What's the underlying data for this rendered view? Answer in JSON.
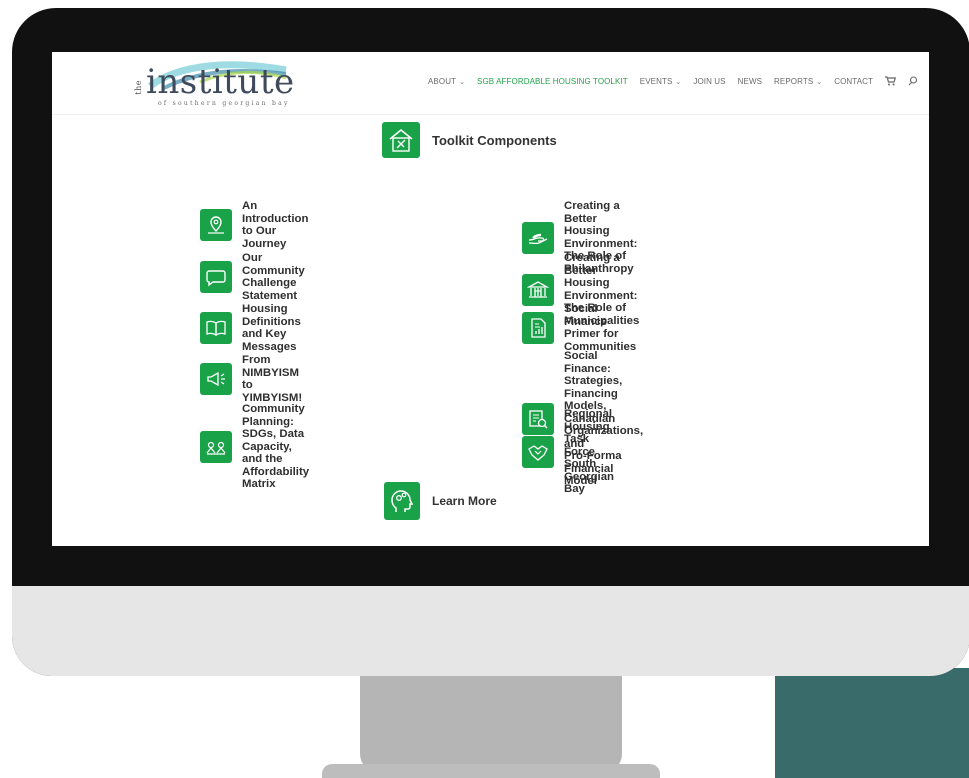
{
  "header": {
    "logo": {
      "prefix": "the",
      "main": "institute",
      "subtitle": "of southern georgian bay"
    },
    "nav": [
      {
        "label": "ABOUT",
        "dropdown": true,
        "active": false
      },
      {
        "label": "SGB AFFORDABLE HOUSING TOOLKIT",
        "dropdown": false,
        "active": true
      },
      {
        "label": "EVENTS",
        "dropdown": true,
        "active": false
      },
      {
        "label": "JOIN US",
        "dropdown": false,
        "active": false
      },
      {
        "label": "NEWS",
        "dropdown": false,
        "active": false
      },
      {
        "label": "REPORTS",
        "dropdown": true,
        "active": false
      },
      {
        "label": "CONTACT",
        "dropdown": false,
        "active": false
      }
    ],
    "nav_chevron": "⌄"
  },
  "main": {
    "title": "Toolkit Components",
    "items_left": [
      {
        "lines": [
          "An Introduction to Our Journey"
        ],
        "icon": "map-pin-icon"
      },
      {
        "lines": [
          "Our Community Challenge Statement"
        ],
        "icon": "speech-bubble-icon"
      },
      {
        "lines": [
          "Housing Definitions and Key Messages"
        ],
        "icon": "book-icon"
      },
      {
        "lines": [
          "From NIMBYISM to YIMBYISM!"
        ],
        "icon": "megaphone-icon"
      },
      {
        "lines": [
          "Community Planning: SDGs, Data",
          "Capacity, and the Affordability Matrix"
        ],
        "icon": "planning-icon"
      }
    ],
    "items_right": [
      {
        "lines": [
          "Creating a Better Housing Environment:",
          "The Role of Philanthropy"
        ],
        "icon": "hand-icon"
      },
      {
        "lines": [
          "Creating a Better Housing Environment:",
          "The Role of Municipalities"
        ],
        "icon": "municipal-building-icon"
      },
      {
        "lines": [
          "Social Finance Primer for Communities"
        ],
        "icon": "document-chart-icon"
      },
      {
        "lines": [
          "Social Finance: Strategies, Financing",
          "Models, Canadian Organizations, and",
          "Pro-Forma Financial Model"
        ],
        "icon": "financial-report-icon"
      },
      {
        "lines": [
          "Regional Housing Task Force South",
          "Georgian Bay"
        ],
        "icon": "handshake-icon"
      }
    ],
    "learn_more": "Learn More"
  },
  "colors": {
    "accent": "#1aa249",
    "nav_active": "#22a34a",
    "monitor_bezel": "#111111",
    "teal_block": "#3a6b6b"
  }
}
